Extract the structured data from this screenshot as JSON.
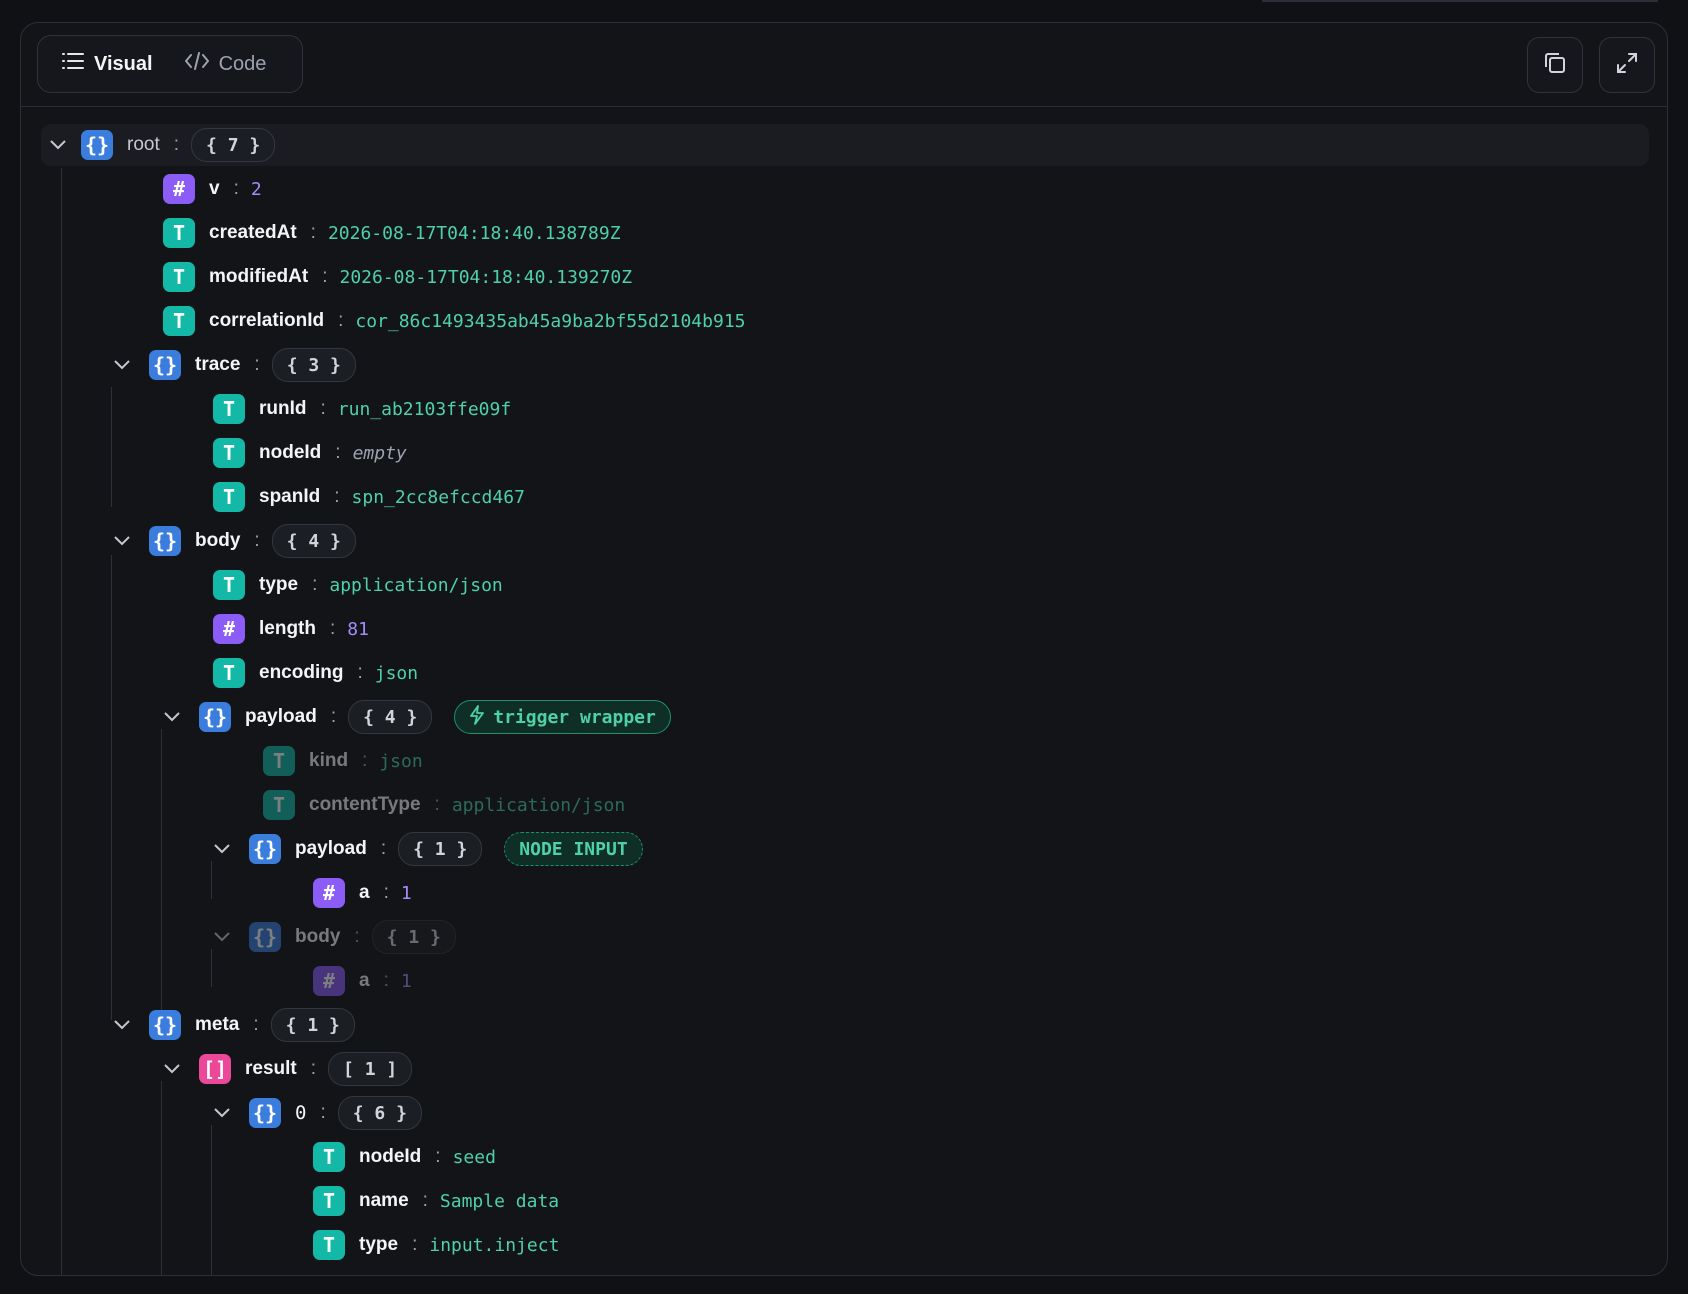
{
  "toolbar": {
    "tabs": [
      {
        "label": "Visual",
        "icon": "list-icon",
        "active": true
      },
      {
        "label": "Code",
        "icon": "code-icon",
        "active": false
      }
    ],
    "copy_icon": "copy-icon",
    "expand_icon": "expand-icon"
  },
  "tree": {
    "root": {
      "key": "root",
      "count": "{ 7 }"
    },
    "v": {
      "key": "v",
      "value": "2"
    },
    "createdAt": {
      "key": "createdAt",
      "value": "2026-08-17T04:18:40.138789Z"
    },
    "modifiedAt": {
      "key": "modifiedAt",
      "value": "2026-08-17T04:18:40.139270Z"
    },
    "correlationId": {
      "key": "correlationId",
      "value": "cor_86c1493435ab45a9ba2bf55d2104b915"
    },
    "trace": {
      "key": "trace",
      "count": "{ 3 }"
    },
    "runId": {
      "key": "runId",
      "value": "run_ab2103ffe09f"
    },
    "nodeId": {
      "key": "nodeId",
      "value": "empty"
    },
    "spanId": {
      "key": "spanId",
      "value": "spn_2cc8efccd467"
    },
    "body": {
      "key": "body",
      "count": "{ 4 }"
    },
    "type": {
      "key": "type",
      "value": "application/json"
    },
    "length": {
      "key": "length",
      "value": "81"
    },
    "encoding": {
      "key": "encoding",
      "value": "json"
    },
    "payload": {
      "key": "payload",
      "count": "{ 4 }",
      "tag": "trigger wrapper"
    },
    "kind": {
      "key": "kind",
      "value": "json"
    },
    "contentType": {
      "key": "contentType",
      "value": "application/json"
    },
    "payload_inner": {
      "key": "payload",
      "count": "{ 1 }",
      "tag": "NODE INPUT"
    },
    "a1": {
      "key": "a",
      "value": "1"
    },
    "body_inner": {
      "key": "body",
      "count": "{ 1 }"
    },
    "a2": {
      "key": "a",
      "value": "1"
    },
    "meta": {
      "key": "meta",
      "count": "{ 1 }"
    },
    "result": {
      "key": "result",
      "count": "[ 1 ]"
    },
    "item0": {
      "key": "0",
      "count": "{ 6 }"
    },
    "nodeId2": {
      "key": "nodeId",
      "value": "seed"
    },
    "name": {
      "key": "name",
      "value": "Sample data"
    },
    "type2": {
      "key": "type",
      "value": "input.inject"
    }
  }
}
